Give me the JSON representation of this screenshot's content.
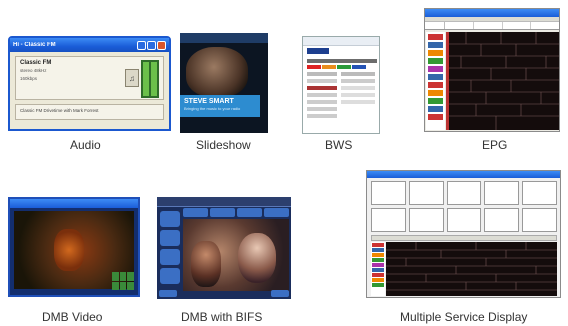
{
  "captions": {
    "audio": "Audio",
    "slideshow": "Slideshow",
    "bws": "BWS",
    "epg": "EPG",
    "dmb_video": "DMB Video",
    "dmb_bifs": "DMB with BIFS",
    "msd": "Multiple Service Display"
  },
  "audio_window": {
    "title": "Hi - Classic FM",
    "station": "Classic FM",
    "meta_line1": "stereo 48kHz",
    "meta_line2": "160kbps",
    "dls": "Classic FM Drivetime with Mark Forrest",
    "play_icon": "speaker-icon"
  },
  "slideshow": {
    "name": "STEVE SMART",
    "subtitle": "Bringing the music to your radio"
  },
  "colors": {
    "xp_blue": "#1a5dd8",
    "epg_dark": "#140c0c",
    "bifs_button": "#3b6fc4",
    "slideshow_band": "#2d8cd0"
  }
}
